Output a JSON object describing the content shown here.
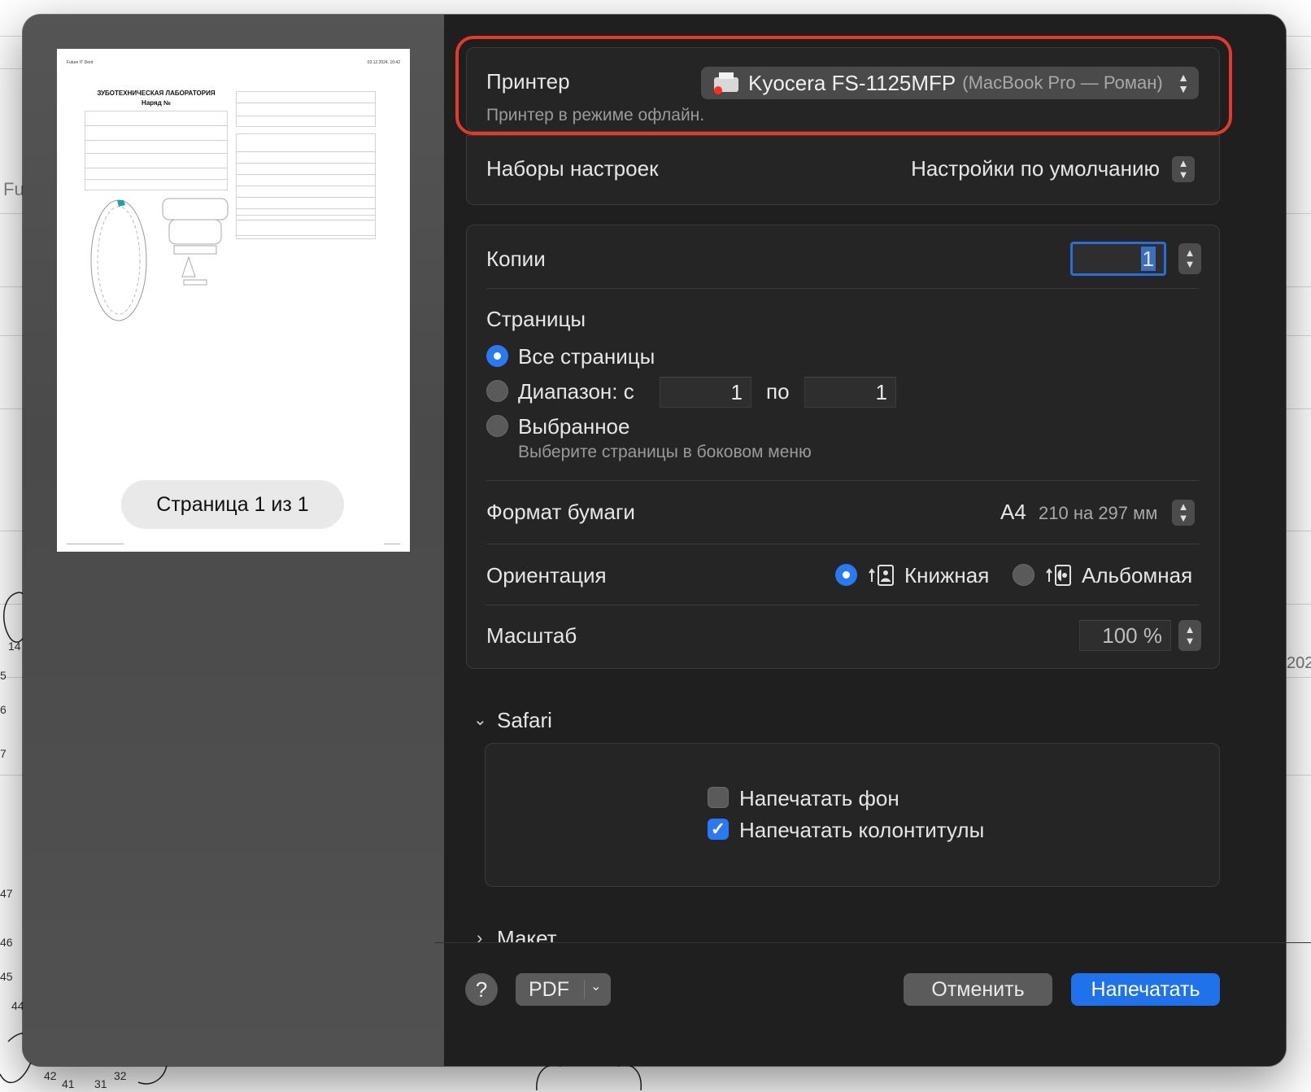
{
  "background": {
    "left_fragments": [
      "Fu",
      "14",
      "5",
      "6",
      "7",
      "47",
      "46",
      "45",
      "44",
      "42",
      "41",
      "31",
      "32"
    ],
    "right_fragment": "202"
  },
  "preview": {
    "doc_header_left": "Future IT Dent",
    "doc_header_right": "03.12.2024, 10:42",
    "doc_title_line1": "ЗУБОТЕХНИЧЕСКАЯ ЛАБОРАТОРИЯ",
    "doc_title_line2": "Наряд №",
    "page_indicator": "Страница 1 из 1"
  },
  "printer": {
    "label": "Принтер",
    "name": "Kyocera FS-1125MFP",
    "host": "(MacBook Pro — Роман)",
    "status": "Принтер в режиме офлайн."
  },
  "presets": {
    "label": "Наборы настроек",
    "value": "Настройки по умолчанию"
  },
  "copies": {
    "label": "Копии",
    "value": "1"
  },
  "pages": {
    "label": "Страницы",
    "all_label": "Все страницы",
    "range_label": "Диапазон: с",
    "range_from": "1",
    "range_to_label": "по",
    "range_to": "1",
    "selection_label": "Выбранное",
    "selection_hint": "Выберите страницы в боковом меню",
    "selected": "all"
  },
  "paper": {
    "label": "Формат бумаги",
    "size": "A4",
    "dims": "210 на 297 мм"
  },
  "orientation": {
    "label": "Ориентация",
    "portrait": "Книжная",
    "landscape": "Альбомная",
    "selected": "portrait"
  },
  "scale": {
    "label": "Масштаб",
    "value": "100 %"
  },
  "safari": {
    "label": "Safari",
    "print_bg": "Напечатать фон",
    "print_bg_checked": false,
    "print_headers": "Напечатать колонтитулы",
    "print_headers_checked": true
  },
  "layout_section": {
    "label": "Макет"
  },
  "footer": {
    "help": "?",
    "pdf": "PDF",
    "cancel": "Отменить",
    "print": "Напечатать"
  },
  "colors": {
    "accent": "#1f72ea",
    "highlight": "#e53a2a",
    "dialog_bg": "#1f1f1f"
  }
}
